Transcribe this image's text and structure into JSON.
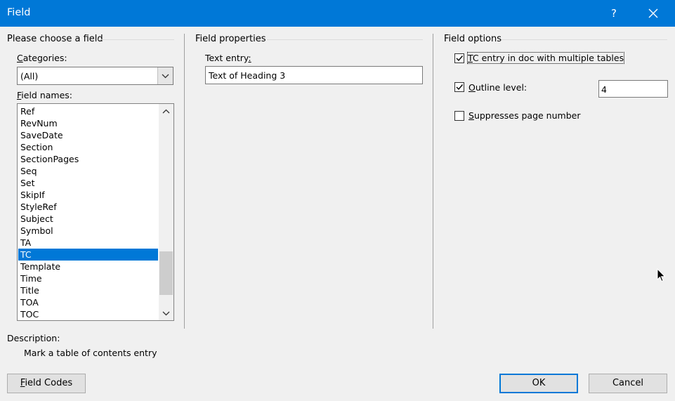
{
  "window": {
    "title": "Field",
    "help_label": "?"
  },
  "left_panel": {
    "heading": "Please choose a field",
    "categories_label_first": "C",
    "categories_label_rest": "ategories:",
    "categories_value": "(All)",
    "field_names_label_first": "F",
    "field_names_label_rest": "ield names:",
    "field_names": [
      "Ref",
      "RevNum",
      "SaveDate",
      "Section",
      "SectionPages",
      "Seq",
      "Set",
      "SkipIf",
      "StyleRef",
      "Subject",
      "Symbol",
      "TA",
      "TC",
      "Template",
      "Time",
      "Title",
      "TOA",
      "TOC"
    ],
    "selected_field": "TC"
  },
  "middle_panel": {
    "heading": "Field properties",
    "text_entry_label_main": "Text entry",
    "text_entry_label_colon": ":",
    "text_entry_value": "Text of Heading 3"
  },
  "right_panel": {
    "heading": "Field options",
    "options": {
      "tc_multiple_tables": {
        "label_first": "T",
        "label_rest": "C entry in doc with multiple tables",
        "checked": true
      },
      "outline_level": {
        "label_first": "O",
        "label_rest": "utline level:",
        "checked": true,
        "value": "4"
      },
      "suppress_page_number": {
        "label_first": "S",
        "label_rest": "uppresses page number",
        "checked": false
      }
    }
  },
  "description": {
    "label": "Description:",
    "text": "Mark a table of contents entry"
  },
  "buttons": {
    "field_codes_first": "F",
    "field_codes_rest": "ield Codes",
    "ok": "OK",
    "cancel": "Cancel"
  },
  "colors": {
    "titlebar": "#0078d7",
    "selection": "#0078d7",
    "background": "#f0f0f0"
  }
}
